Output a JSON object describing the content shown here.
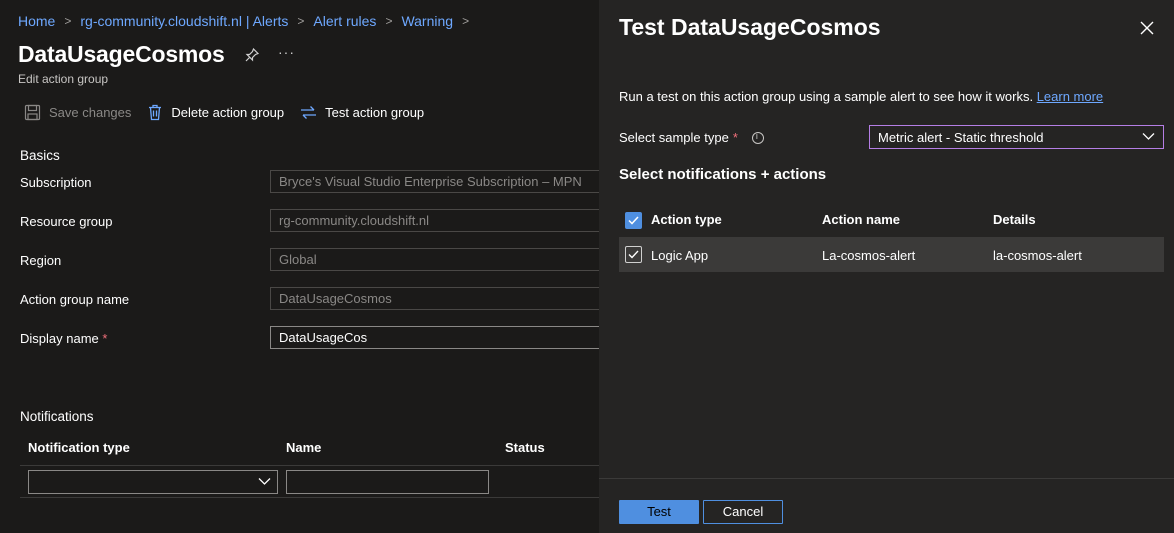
{
  "breadcrumb": [
    "Home",
    "rg-community.cloudshift.nl | Alerts",
    "Alert rules",
    "Warning"
  ],
  "page": {
    "title": "DataUsageCosmos",
    "subtitle": "Edit action group",
    "more_label": "···"
  },
  "toolbar": {
    "save_label": "Save changes",
    "delete_label": "Delete action group",
    "test_label": "Test action group"
  },
  "basics": {
    "heading": "Basics",
    "subscription_label": "Subscription",
    "subscription_value": "Bryce's Visual Studio Enterprise Subscription – MPN",
    "resource_group_label": "Resource group",
    "resource_group_value": "rg-community.cloudshift.nl",
    "region_label": "Region",
    "region_value": "Global",
    "action_group_name_label": "Action group name",
    "action_group_name_value": "DataUsageCosmos",
    "display_name_label": "Display name",
    "display_name_required": "*",
    "display_name_value": "DataUsageCos"
  },
  "notifications": {
    "heading": "Notifications",
    "col_type": "Notification type",
    "col_name": "Name",
    "col_status": "Status",
    "type_value": "",
    "name_value": ""
  },
  "panel": {
    "title": "Test DataUsageCosmos",
    "description": "Run a test on this action group using a sample alert to see how it works.",
    "learn_more": "Learn more",
    "sample_type_label": "Select sample type",
    "sample_type_required": "*",
    "sample_type_value": "Metric alert - Static threshold",
    "sub_heading": "Select notifications + actions",
    "table": {
      "headers": [
        "Action type",
        "Action name",
        "Details"
      ],
      "rows": [
        {
          "type": "Logic App",
          "name": "La-cosmos-alert",
          "details": "la-cosmos-alert",
          "checked": true
        }
      ]
    },
    "test_button": "Test",
    "cancel_button": "Cancel"
  },
  "colors": {
    "accent": "#4f8fe0",
    "link": "#6ea8ff",
    "select_focus": "#b57ee5",
    "required": "#f1707b"
  }
}
